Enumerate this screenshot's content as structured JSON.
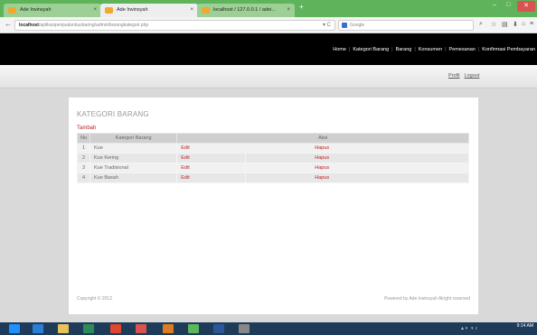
{
  "browser": {
    "tabs": [
      {
        "label": "Ade Irwinsyah",
        "favicon_color": "#f0a830"
      },
      {
        "label": "Ade Irwinsyah",
        "favicon_color": "#f0a830"
      },
      {
        "label": "localhost / 127.0.0.1 / adei...",
        "favicon_color": "#f0a830"
      }
    ],
    "new_tab": "+",
    "url_host": "localhost",
    "url_path": "/aplikasipenjualanbusbaring/admin/barangkategori.php",
    "search_placeholder": "Google",
    "window_min": "–",
    "window_max": "□",
    "window_close": "✕"
  },
  "site": {
    "menu": [
      "Home",
      "Kategori Barang",
      "Barang",
      "Konsumen",
      "Pemesanan",
      "Konfirmasi Pembayaran"
    ],
    "user_links": [
      "Profil",
      "Logout"
    ]
  },
  "page": {
    "title": "KATEGORI BARANG",
    "add_link": "Tambah",
    "table": {
      "headers": [
        "No",
        "Kategori Barang",
        "Aksi"
      ],
      "rows": [
        {
          "no": "1",
          "name": "Kue",
          "edit": "Edit",
          "delete": "Hapus"
        },
        {
          "no": "2",
          "name": "Kue Kering",
          "edit": "Edit",
          "delete": "Hapus"
        },
        {
          "no": "3",
          "name": "Kue Tradisional",
          "edit": "Edit",
          "delete": "Hapus"
        },
        {
          "no": "4",
          "name": "Kue Basah",
          "edit": "Edit",
          "delete": "Hapus"
        }
      ]
    },
    "copyright": "Copyright © 2012",
    "powered": "Powered by Ade Irwinsyah Alright reserved"
  },
  "taskbar": {
    "time": "9:14 AM",
    "date": "",
    "apps": [
      {
        "name": "start-icon",
        "color": "#1e90ff"
      },
      {
        "name": "ie-icon",
        "color": "#2a7fd4"
      },
      {
        "name": "explorer-icon",
        "color": "#e8c15a"
      },
      {
        "name": "app-icon",
        "color": "#2e8b57"
      },
      {
        "name": "chrome-icon",
        "color": "#e0462b"
      },
      {
        "name": "app-icon-2",
        "color": "#d9534f"
      },
      {
        "name": "firefox-icon",
        "color": "#e07b22"
      },
      {
        "name": "app-icon-3",
        "color": "#5cb85c"
      },
      {
        "name": "word-icon",
        "color": "#2b579a"
      },
      {
        "name": "app-icon-4",
        "color": "#888888"
      }
    ]
  },
  "colors": {
    "accent_link": "#b22222",
    "header_bg": "#000000",
    "titlebar": "#5fb35a"
  }
}
